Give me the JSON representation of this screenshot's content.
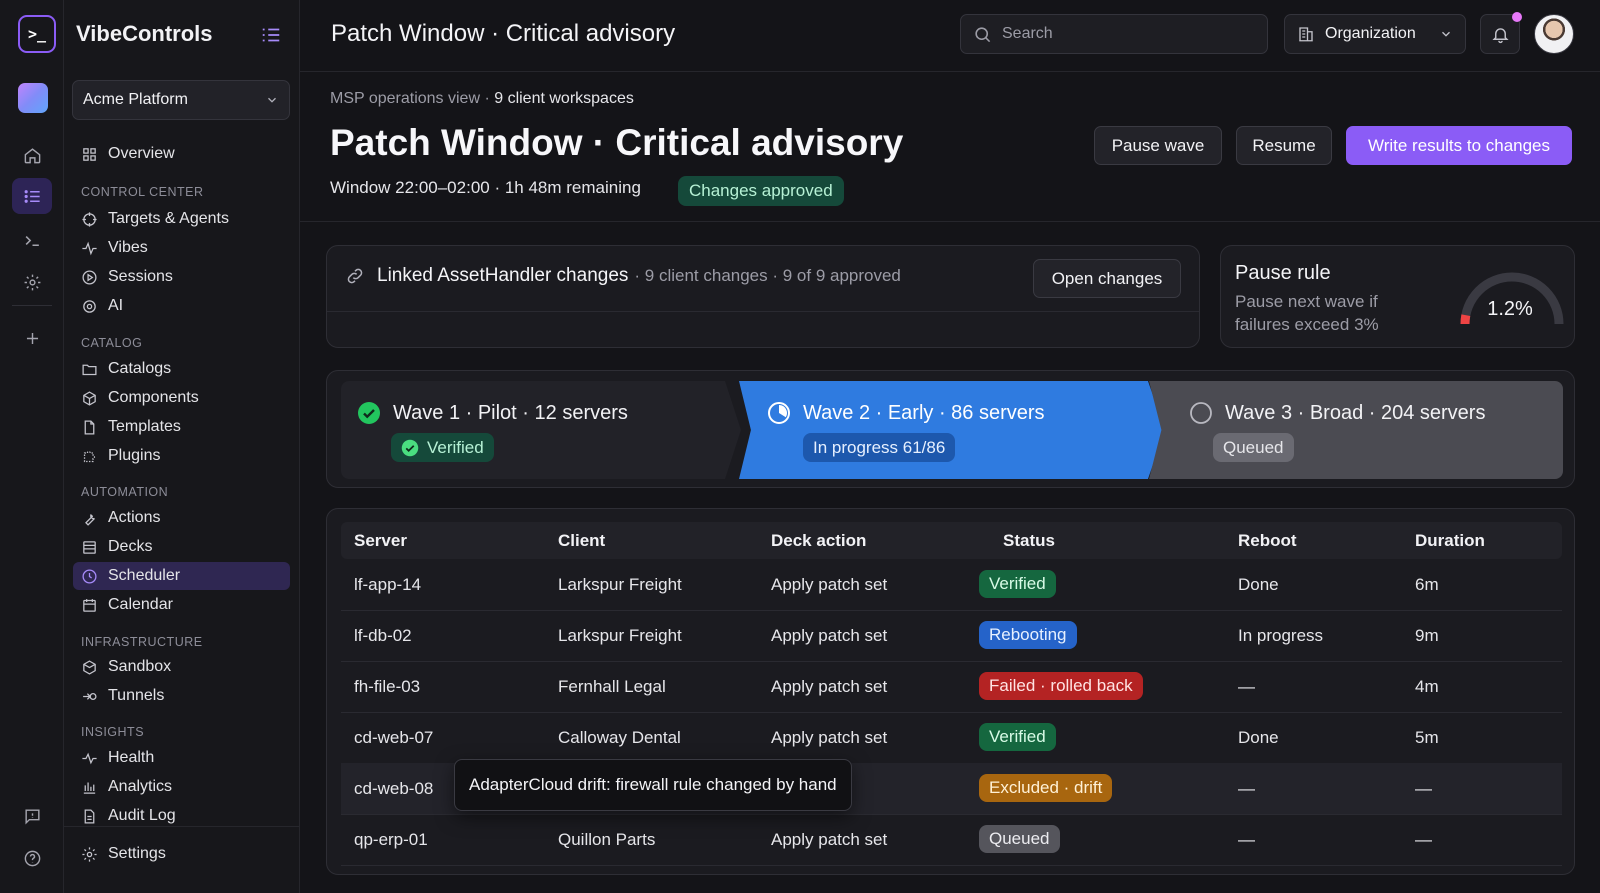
{
  "app": {
    "brand": "VibeControls",
    "workspace": "Acme Platform"
  },
  "sidebar": {
    "overview": "Overview",
    "sections": [
      {
        "title": "CONTROL CENTER",
        "items": [
          "Targets & Agents",
          "Vibes",
          "Sessions",
          "AI"
        ]
      },
      {
        "title": "CATALOG",
        "items": [
          "Catalogs",
          "Components",
          "Templates",
          "Plugins"
        ]
      },
      {
        "title": "AUTOMATION",
        "items": [
          "Actions",
          "Decks",
          "Scheduler",
          "Calendar"
        ]
      },
      {
        "title": "INFRASTRUCTURE",
        "items": [
          "Sandbox",
          "Tunnels"
        ]
      },
      {
        "title": "INSIGHTS",
        "items": [
          "Health",
          "Analytics",
          "Audit Log"
        ]
      }
    ],
    "settings": "Settings",
    "active": "Scheduler"
  },
  "topbar": {
    "title": "Patch Window · Critical advisory",
    "search_placeholder": "Search",
    "org_label": "Organization"
  },
  "header": {
    "crumb_prefix": "MSP operations view · ",
    "crumb_value": "9 client workspaces",
    "title": "Patch Window · Critical advisory",
    "window_info": "Window 22:00–02:00 · 1h 48m remaining",
    "badge": "Changes approved",
    "pause_label": "Pause wave",
    "resume_label": "Resume",
    "write_label": "Write results to changes"
  },
  "linked": {
    "title": "Linked AssetHandler changes",
    "meta": "· 9 client changes · 9 of 9 approved",
    "open_label": "Open changes"
  },
  "pause_rule": {
    "title": "Pause rule",
    "description": "Pause next wave if failures exceed 3%",
    "value_label": "1.2%",
    "value": 1.2,
    "threshold": 3
  },
  "waves": [
    {
      "title": "Wave 1 · Pilot · 12 servers",
      "badge": "Verified",
      "state": "done"
    },
    {
      "title": "Wave 2 · Early · 86 servers",
      "badge": "In progress 61/86",
      "state": "progress"
    },
    {
      "title": "Wave 3 · Broad · 204 servers",
      "badge": "Queued",
      "state": "queued"
    }
  ],
  "table": {
    "columns": [
      "Server",
      "Client",
      "Deck action",
      "Status",
      "Reboot",
      "Duration"
    ],
    "rows": [
      {
        "server": "lf-app-14",
        "client": "Larkspur Freight",
        "action": "Apply patch set",
        "status": "Verified",
        "status_kind": "verified",
        "reboot": "Done",
        "duration": "6m"
      },
      {
        "server": "lf-db-02",
        "client": "Larkspur Freight",
        "action": "Apply patch set",
        "status": "Rebooting",
        "status_kind": "rebooting",
        "reboot": "In progress",
        "duration": "9m"
      },
      {
        "server": "fh-file-03",
        "client": "Fernhall Legal",
        "action": "Apply patch set",
        "status": "Failed · rolled back",
        "status_kind": "failed",
        "reboot": "—",
        "duration": "4m"
      },
      {
        "server": "cd-web-07",
        "client": "Calloway Dental",
        "action": "Apply patch set",
        "status": "Verified",
        "status_kind": "verified",
        "reboot": "Done",
        "duration": "5m"
      },
      {
        "server": "cd-web-08",
        "client": "",
        "action": "",
        "status": "Excluded · drift",
        "status_kind": "excluded",
        "reboot": "—",
        "duration": "—"
      },
      {
        "server": "qp-erp-01",
        "client": "Quillon Parts",
        "action": "Apply patch set",
        "status": "Queued",
        "status_kind": "queued",
        "reboot": "—",
        "duration": "—"
      }
    ]
  },
  "tooltip": "AdapterCloud drift: firewall rule changed by hand",
  "colors": {
    "accent": "#8b5cf6",
    "verified_bg": "#15673f",
    "rebooting_bg": "#2563c9",
    "failed_bg": "#b42323",
    "excluded_bg": "#a8660f",
    "queued_bg": "#55555c"
  }
}
